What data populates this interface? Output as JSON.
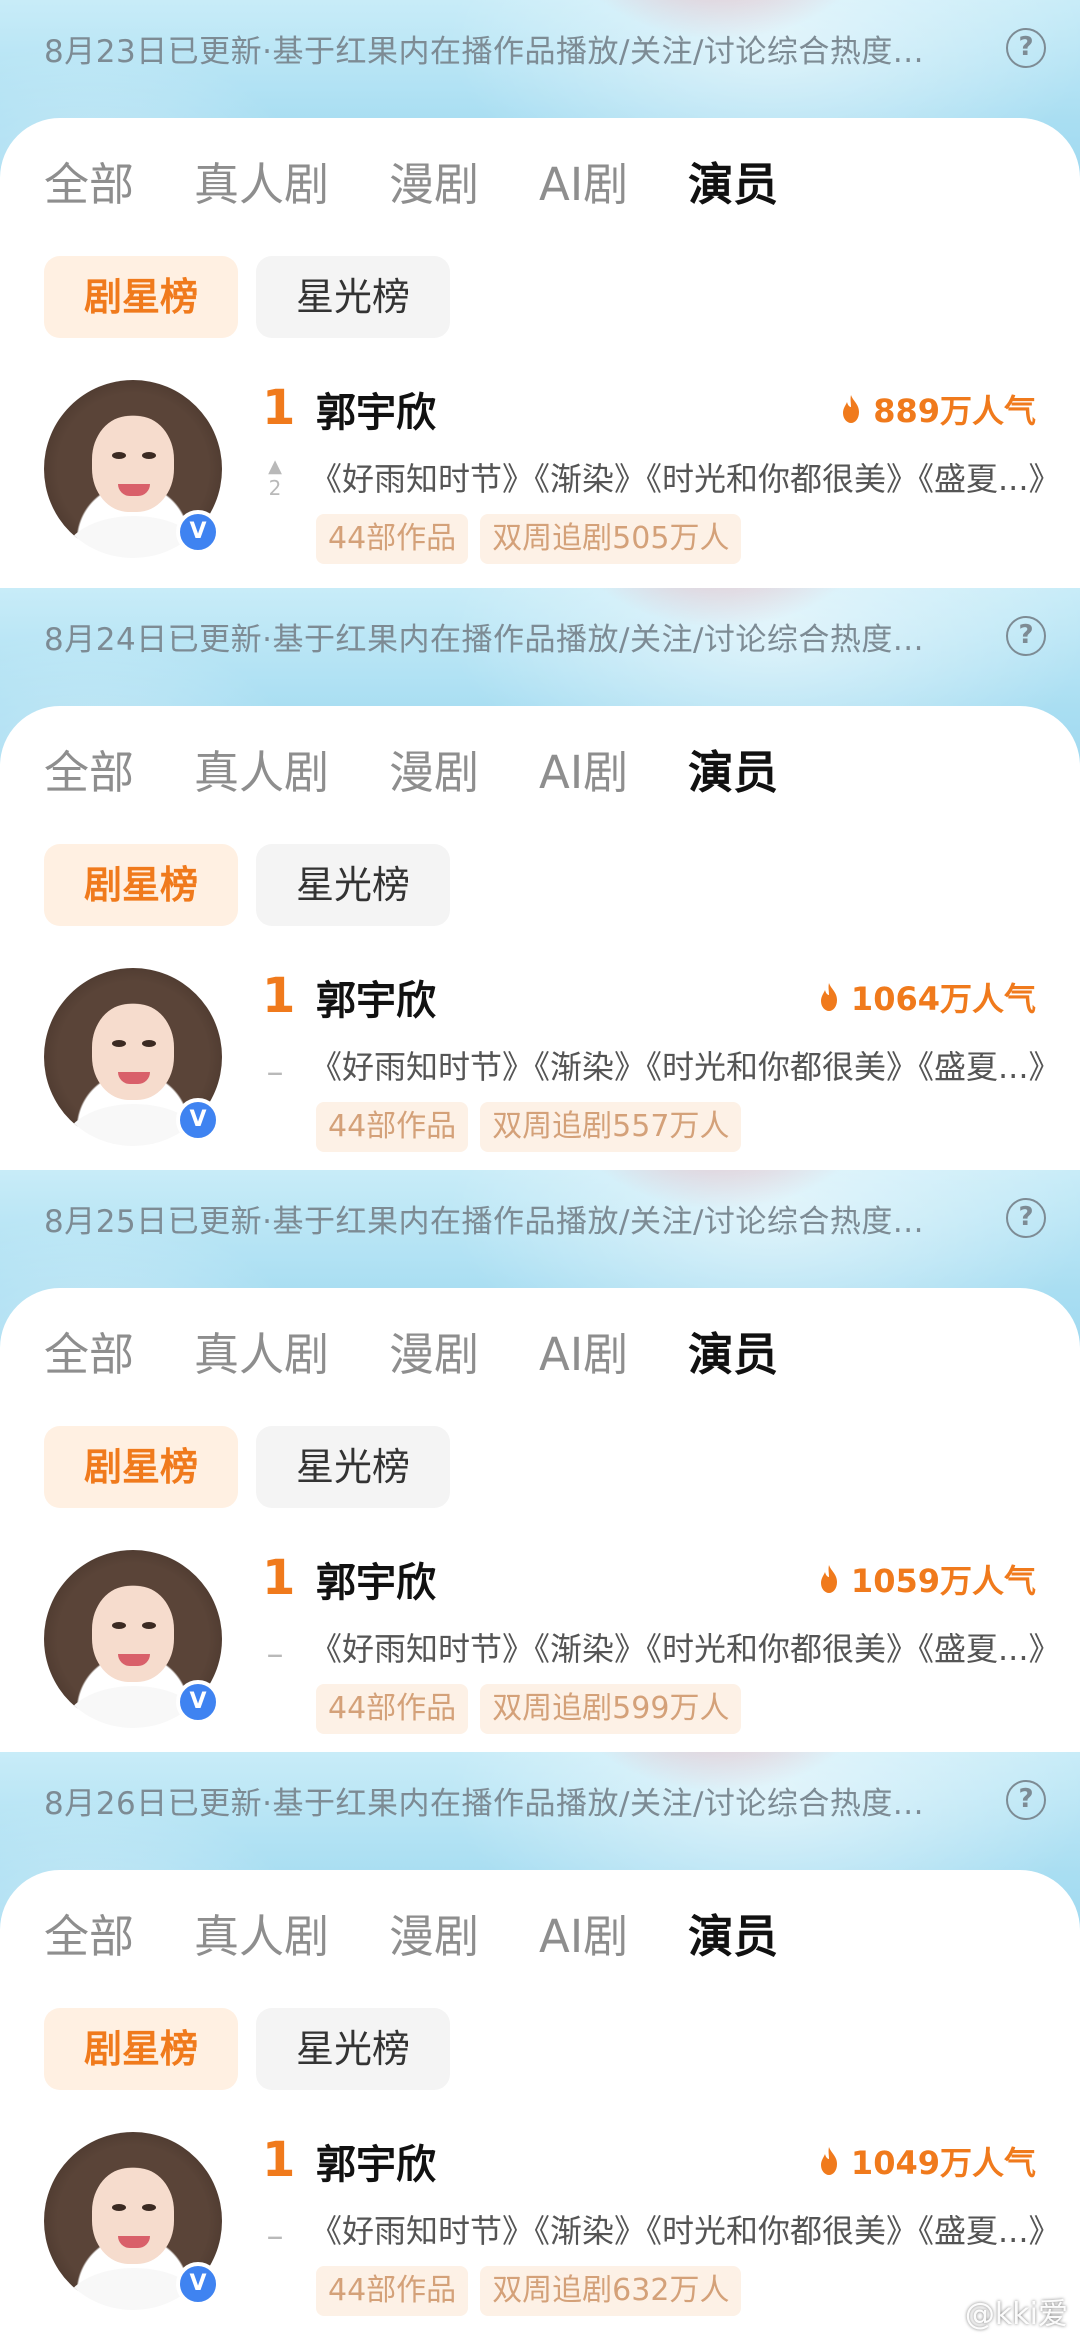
{
  "panels": [
    {
      "update_text": "8月23日已更新·基于红果内在播作品播放/关注/讨论综合热度...",
      "help_icon": "?",
      "tabs": [
        "全部",
        "真人剧",
        "漫剧",
        "AI剧",
        "演员"
      ],
      "subtabs": [
        "剧星榜",
        "星光榜"
      ],
      "rank": "1",
      "rank_change_arrow": "▲",
      "rank_change": "2",
      "name": "郭宇欣",
      "popularity": "889万人气",
      "works": "《好雨知时节》《渐染》《时光和你都很美》《盛夏...》",
      "tags": [
        "44部作品",
        "双周追剧505万人"
      ],
      "badge": "V"
    },
    {
      "update_text": "8月24日已更新·基于红果内在播作品播放/关注/讨论综合热度...",
      "help_icon": "?",
      "tabs": [
        "全部",
        "真人剧",
        "漫剧",
        "AI剧",
        "演员"
      ],
      "subtabs": [
        "剧星榜",
        "星光榜"
      ],
      "rank": "1",
      "rank_change": "–",
      "name": "郭宇欣",
      "popularity": "1064万人气",
      "works": "《好雨知时节》《渐染》《时光和你都很美》《盛夏...》",
      "tags": [
        "44部作品",
        "双周追剧557万人"
      ],
      "badge": "V"
    },
    {
      "update_text": "8月25日已更新·基于红果内在播作品播放/关注/讨论综合热度...",
      "help_icon": "?",
      "tabs": [
        "全部",
        "真人剧",
        "漫剧",
        "AI剧",
        "演员"
      ],
      "subtabs": [
        "剧星榜",
        "星光榜"
      ],
      "rank": "1",
      "rank_change": "–",
      "name": "郭宇欣",
      "popularity": "1059万人气",
      "works": "《好雨知时节》《渐染》《时光和你都很美》《盛夏...》",
      "tags": [
        "44部作品",
        "双周追剧599万人"
      ],
      "badge": "V"
    },
    {
      "update_text": "8月26日已更新·基于红果内在播作品播放/关注/讨论综合热度...",
      "help_icon": "?",
      "tabs": [
        "全部",
        "真人剧",
        "漫剧",
        "AI剧",
        "演员"
      ],
      "subtabs": [
        "剧星榜",
        "星光榜"
      ],
      "rank": "1",
      "rank_change": "–",
      "name": "郭宇欣",
      "popularity": "1049万人气",
      "works": "《好雨知时节》《渐染》《时光和你都很美》《盛夏...》",
      "tags": [
        "44部作品",
        "双周追剧632万人"
      ],
      "badge": "V"
    }
  ],
  "active_tab_index": 4,
  "active_subtab_index": 0,
  "colors": {
    "accent": "#f07a1c",
    "tag_bg": "#fdf1e6",
    "tag_text": "#d4a179",
    "badge": "#3f83f1",
    "banner": "#a9def2"
  },
  "watermark": "@kki爱"
}
